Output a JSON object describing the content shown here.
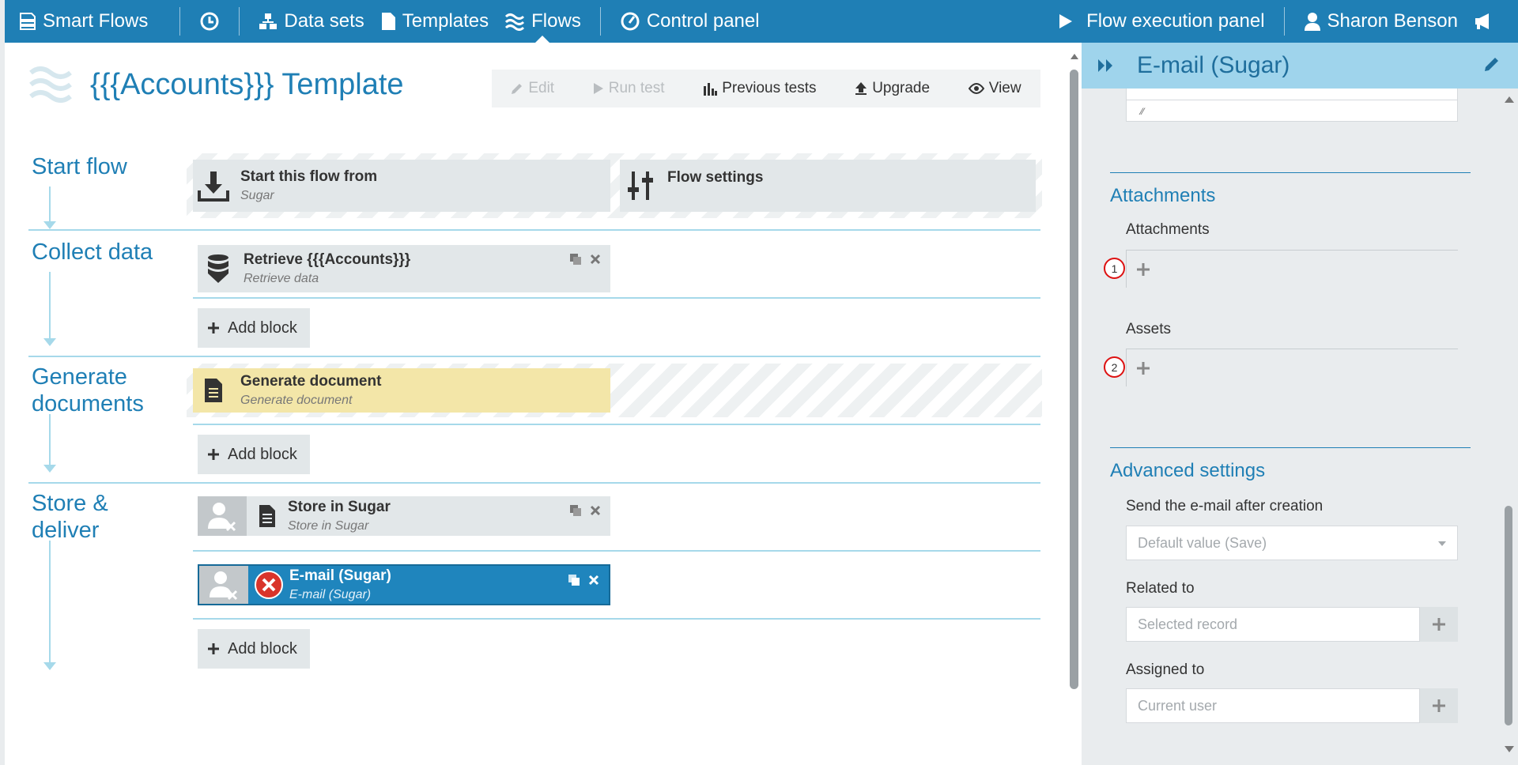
{
  "navbar": {
    "brand": "Smart Flows",
    "items": [
      {
        "label": "Data sets"
      },
      {
        "label": "Templates"
      },
      {
        "label": "Flows"
      },
      {
        "label": "Control panel"
      }
    ],
    "execution_panel": "Flow execution panel",
    "user_name": "Sharon Benson"
  },
  "page": {
    "title": "{{{Accounts}}} Template",
    "toolbar": {
      "edit": "Edit",
      "run_test": "Run test",
      "previous_tests": "Previous tests",
      "upgrade": "Upgrade",
      "view": "View"
    }
  },
  "stages": {
    "start": {
      "label": "Start flow",
      "blocks": [
        {
          "title": "Start this flow from",
          "subtitle": "Sugar"
        },
        {
          "title": "Flow settings",
          "subtitle": ""
        }
      ]
    },
    "collect": {
      "label": "Collect data",
      "blocks": [
        {
          "title": "Retrieve {{{Accounts}}}",
          "subtitle": "Retrieve data"
        }
      ],
      "add_label": "Add block"
    },
    "generate": {
      "label": "Generate documents",
      "blocks": [
        {
          "title": "Generate document",
          "subtitle": "Generate document"
        }
      ],
      "add_label": "Add block"
    },
    "store": {
      "label": "Store & deliver",
      "blocks": [
        {
          "title": "Store in Sugar",
          "subtitle": "Store in Sugar"
        },
        {
          "title": "E-mail (Sugar)",
          "subtitle": "E-mail (Sugar)"
        }
      ],
      "add_label": "Add block"
    }
  },
  "side_panel": {
    "title": "E-mail (Sugar)",
    "attachments_section": "Attachments",
    "attachments_label": "Attachments",
    "attachments_badge": "1",
    "assets_label": "Assets",
    "assets_badge": "2",
    "advanced_section": "Advanced settings",
    "send_after_label": "Send the e-mail after creation",
    "send_after_value": "Default value (Save)",
    "related_to_label": "Related to",
    "related_to_placeholder": "Selected record",
    "assigned_to_label": "Assigned to",
    "assigned_to_placeholder": "Current user"
  },
  "colors": {
    "brand": "#1f7fb5",
    "side_header": "#9fd4ec",
    "selected_block": "#1f85bd",
    "yellow_block": "#f3e6a8",
    "error": "#d9342b"
  }
}
